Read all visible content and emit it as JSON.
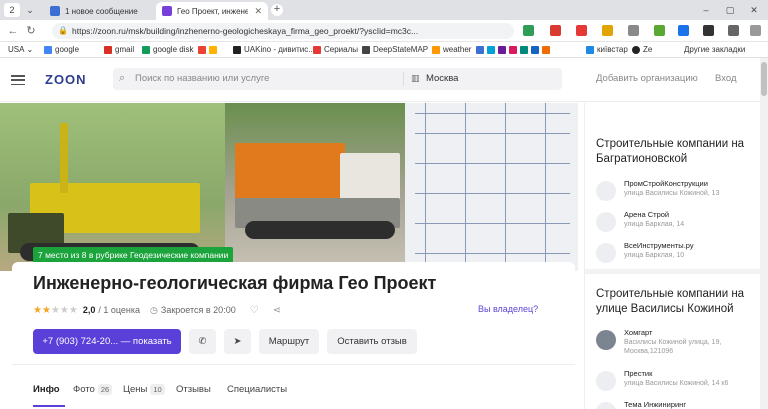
{
  "browser": {
    "tab_counter": "2",
    "tabs": [
      {
        "label": "1 новое сообщение",
        "fav_color": "#3b6fd4"
      },
      {
        "label": "Гео Проект, инженерно",
        "fav_color": "#7b3fd9"
      }
    ],
    "url": "https://zoon.ru/msk/building/inzhenerno-geologicheskaya_firma_geo_proekt/?yscIid=mc3c...",
    "bookmarks": [
      {
        "label": "USA",
        "color": "#888888"
      },
      {
        "label": "google",
        "color": "#4285f4"
      },
      {
        "label": "gmail",
        "color": "#d93025"
      },
      {
        "label": "google disk",
        "color": "#0f9d58"
      },
      {
        "label": "",
        "color": "#ea4335"
      },
      {
        "label": "UAKino - дивитис...",
        "color": "#222222"
      },
      {
        "label": "Сериалы",
        "color": "#e53935"
      },
      {
        "label": "DeepStateMAP",
        "color": "#444444"
      },
      {
        "label": "weather",
        "color": "#ff9800"
      },
      {
        "label": "київстар",
        "color": "#1e88e5"
      },
      {
        "label": "Ze",
        "color": "#222222"
      },
      {
        "label": "Другие закладки",
        "color": "#f6c344"
      }
    ]
  },
  "site": {
    "logo": "ZOON",
    "search_placeholder": "Поиск по названию или услуге",
    "city": "Москва",
    "add_org": "Добавить организацию",
    "login": "Вход"
  },
  "org": {
    "rank_badge": "7 место из 8 в рубрике Геодезические компании",
    "title": "Инженерно-геологическая фирма Гео Проект",
    "rating": 2.0,
    "rating_text": "2,0",
    "rating_count": "/ 1 оценка",
    "hours": "Закроется в 20:00",
    "owner_link": "Вы владелец?",
    "phone_button": "+7 (903) 724-20... — показать",
    "route_button": "Маршрут",
    "review_button": "Оставить отзыв"
  },
  "content_tabs": [
    {
      "label": "Инфо",
      "count": ""
    },
    {
      "label": "Фото",
      "count": "26"
    },
    {
      "label": "Цены",
      "count": "10"
    },
    {
      "label": "Отзывы",
      "count": ""
    },
    {
      "label": "Специалисты",
      "count": ""
    }
  ],
  "sidebar": {
    "section1_title": "Строительные компании на Багратионовской",
    "section1_items": [
      {
        "name": "ПромСтройКонструкции",
        "address": "улица Василисы Кожиной, 13"
      },
      {
        "name": "Арена Строй",
        "address": "улица Барклая, 14"
      },
      {
        "name": "ВсеИнструменты.ру",
        "address": "улица Барклая, 10"
      }
    ],
    "section2_title": "Строительные компании на улице Василисы Кожиной",
    "section2_items": [
      {
        "name": "Хомгарт",
        "address": "Василисы Кожиной улица, 19,",
        "address2": "Москва,121096"
      },
      {
        "name": "Престик",
        "address": "улица Василисы Кожиной, 14 к6",
        "address2": ""
      },
      {
        "name": "Тема Инжиниринг",
        "address": "",
        "address2": ""
      }
    ]
  }
}
